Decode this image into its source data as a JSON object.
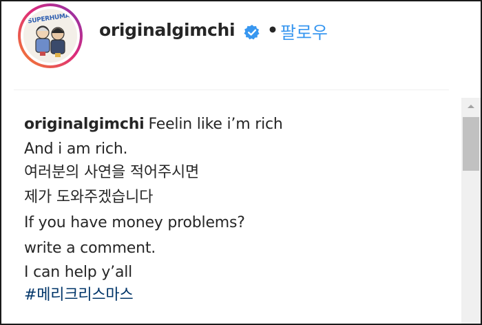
{
  "header": {
    "avatar_logo_text": "SUPERHUMANS",
    "username": "originalgimchi",
    "verified_icon": "verified-check-icon",
    "separator": "•",
    "follow_label": "팔로우"
  },
  "caption": {
    "username": "originalgimchi",
    "first_line_text": "Feelin like i’m rich",
    "lines": [
      "And i am rich.",
      "여러분의 사연을 적어주시면",
      "제가 도와주겠습니다",
      "If you have money problems?",
      "write a comment.",
      "I can help y’all"
    ],
    "hashtag": "#메리크리스마스"
  },
  "colors": {
    "link_blue": "#3897f0",
    "hashtag_blue": "#003569",
    "text": "#262626",
    "verified_blue": "#3897f0"
  },
  "scrollbar": {
    "up_arrow_icon": "scroll-up-arrow-icon"
  }
}
